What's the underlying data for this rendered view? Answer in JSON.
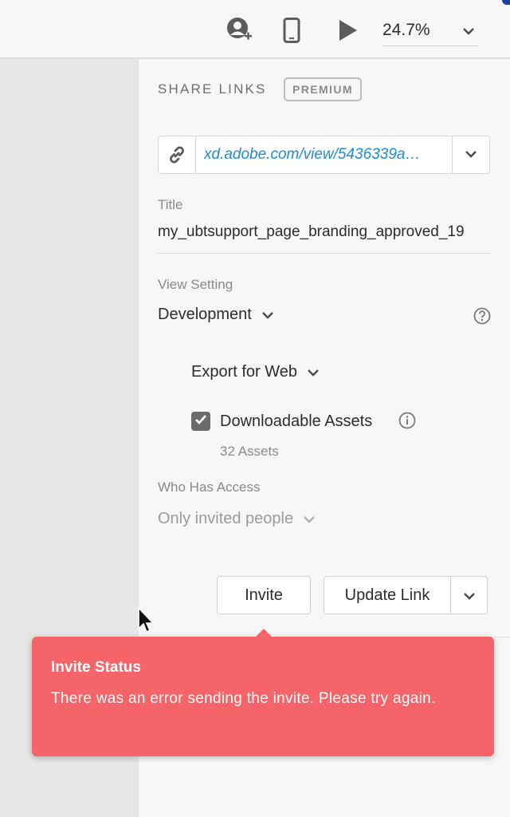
{
  "topbar": {
    "icons": [
      "user-plus-icon",
      "mobile-device-icon",
      "play-icon",
      "chevron-down-icon"
    ],
    "zoom_value": "24.7%"
  },
  "share": {
    "section_title": "SHARE LINKS",
    "badge": "PREMIUM",
    "link_url": "xd.adobe.com/view/5436339a…",
    "title_label": "Title",
    "title_value": "my_ubtsupport_page_branding_approved_19",
    "view_setting_label": "View Setting",
    "view_setting_value": "Development",
    "export_value": "Export for Web",
    "downloadable_label": "Downloadable Assets",
    "downloadable_checked": true,
    "assets_count": "32 Assets",
    "access_label": "Who Has Access",
    "access_value": "Only invited people",
    "invite_button": "Invite",
    "update_button": "Update Link"
  },
  "toast": {
    "title": "Invite Status",
    "message": "There was an error sending the invite. Please try again.",
    "color": "#f56468"
  },
  "colors": {
    "link": "#1d8cd6",
    "panel_bg": "#f7f7f7",
    "canvas_bg": "#e6e6e6"
  }
}
